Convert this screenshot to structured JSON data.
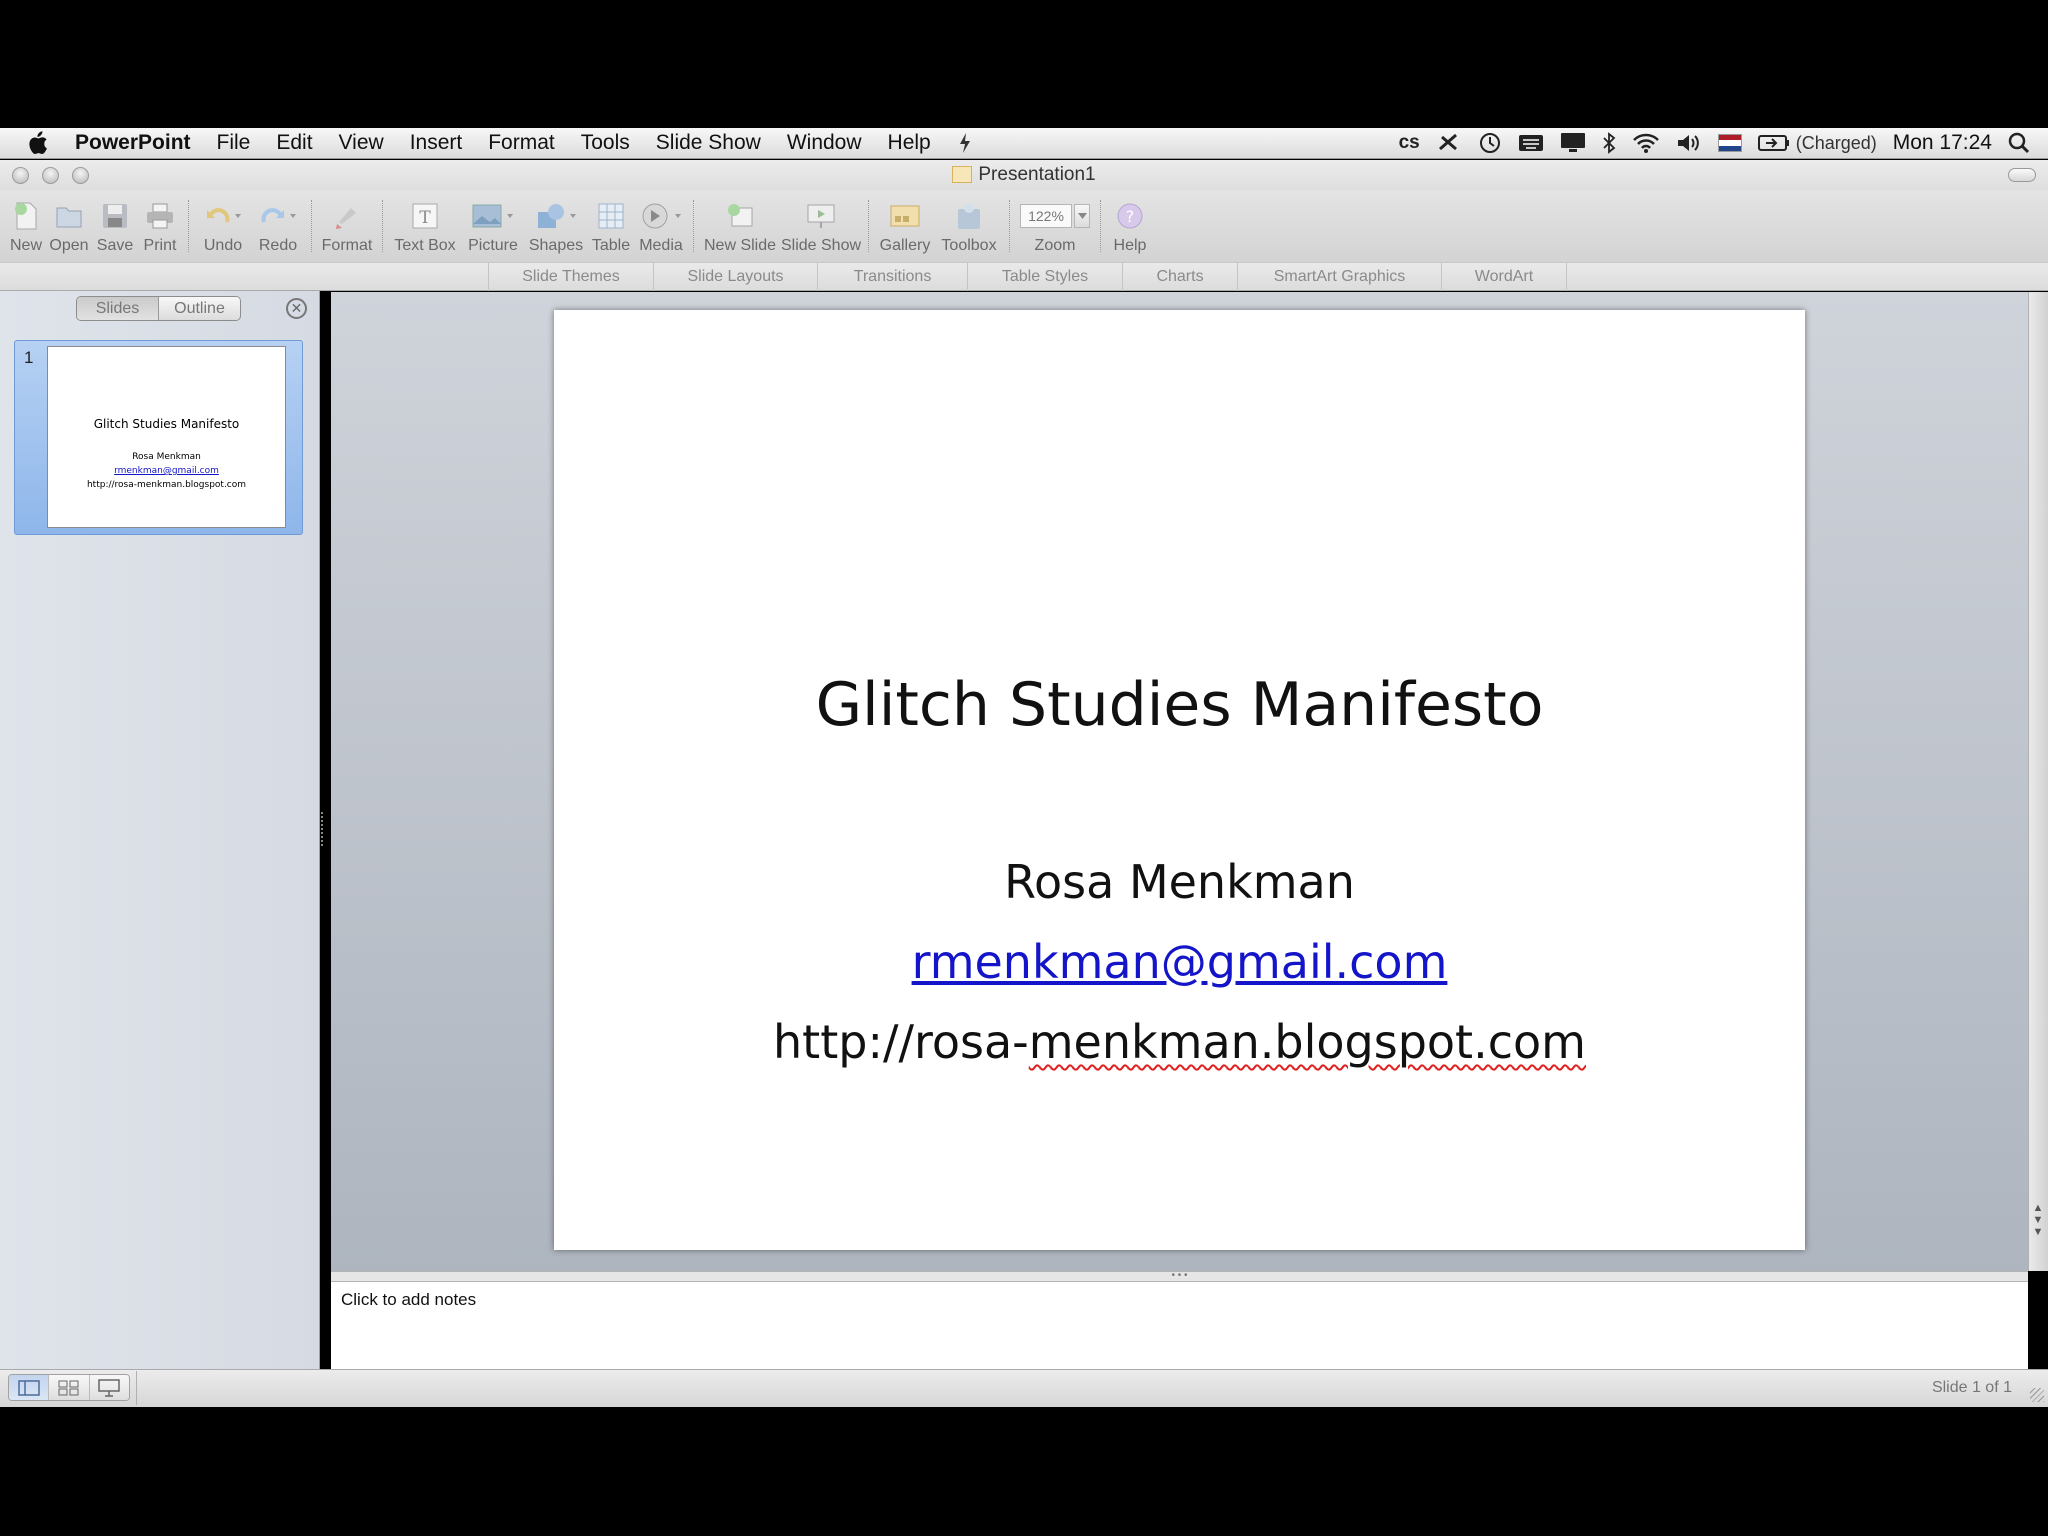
{
  "menubar": {
    "app_name": "PowerPoint",
    "items": [
      "File",
      "Edit",
      "View",
      "Insert",
      "Format",
      "Tools",
      "Slide Show",
      "Window",
      "Help"
    ],
    "battery_status": "(Charged)",
    "clock": "Mon 17:24"
  },
  "window": {
    "title": "Presentation1"
  },
  "toolbar": {
    "new": "New",
    "open": "Open",
    "save": "Save",
    "print": "Print",
    "undo": "Undo",
    "redo": "Redo",
    "format": "Format",
    "text_box": "Text Box",
    "picture": "Picture",
    "shapes": "Shapes",
    "table": "Table",
    "media": "Media",
    "new_slide": "New Slide",
    "slide_show": "Slide Show",
    "gallery": "Gallery",
    "toolbox": "Toolbox",
    "zoom_value": "122%",
    "zoom": "Zoom",
    "help": "Help"
  },
  "ribbon_tabs": [
    "Slide Themes",
    "Slide Layouts",
    "Transitions",
    "Table Styles",
    "Charts",
    "SmartArt Graphics",
    "WordArt"
  ],
  "sidebar": {
    "tab_slides": "Slides",
    "tab_outline": "Outline",
    "thumbnail": {
      "number": "1",
      "title": "Glitch Studies Manifesto",
      "name": "Rosa Menkman",
      "email": "rmenkman@gmail.com",
      "url": "http://rosa-menkman.blogspot.com"
    }
  },
  "slide": {
    "title": "Glitch Studies Manifesto",
    "name": "Rosa Menkman",
    "email": "rmenkman@gmail.com",
    "url_prefix": "http://rosa-",
    "url_rest": "menkman.blogspot.com"
  },
  "notes": {
    "placeholder": "Click to add notes"
  },
  "status": {
    "slide_count": "Slide 1 of 1"
  },
  "colors": {
    "link": "#1414c8",
    "selection": "#8eb6ea",
    "spellcheck": "#e02020"
  }
}
